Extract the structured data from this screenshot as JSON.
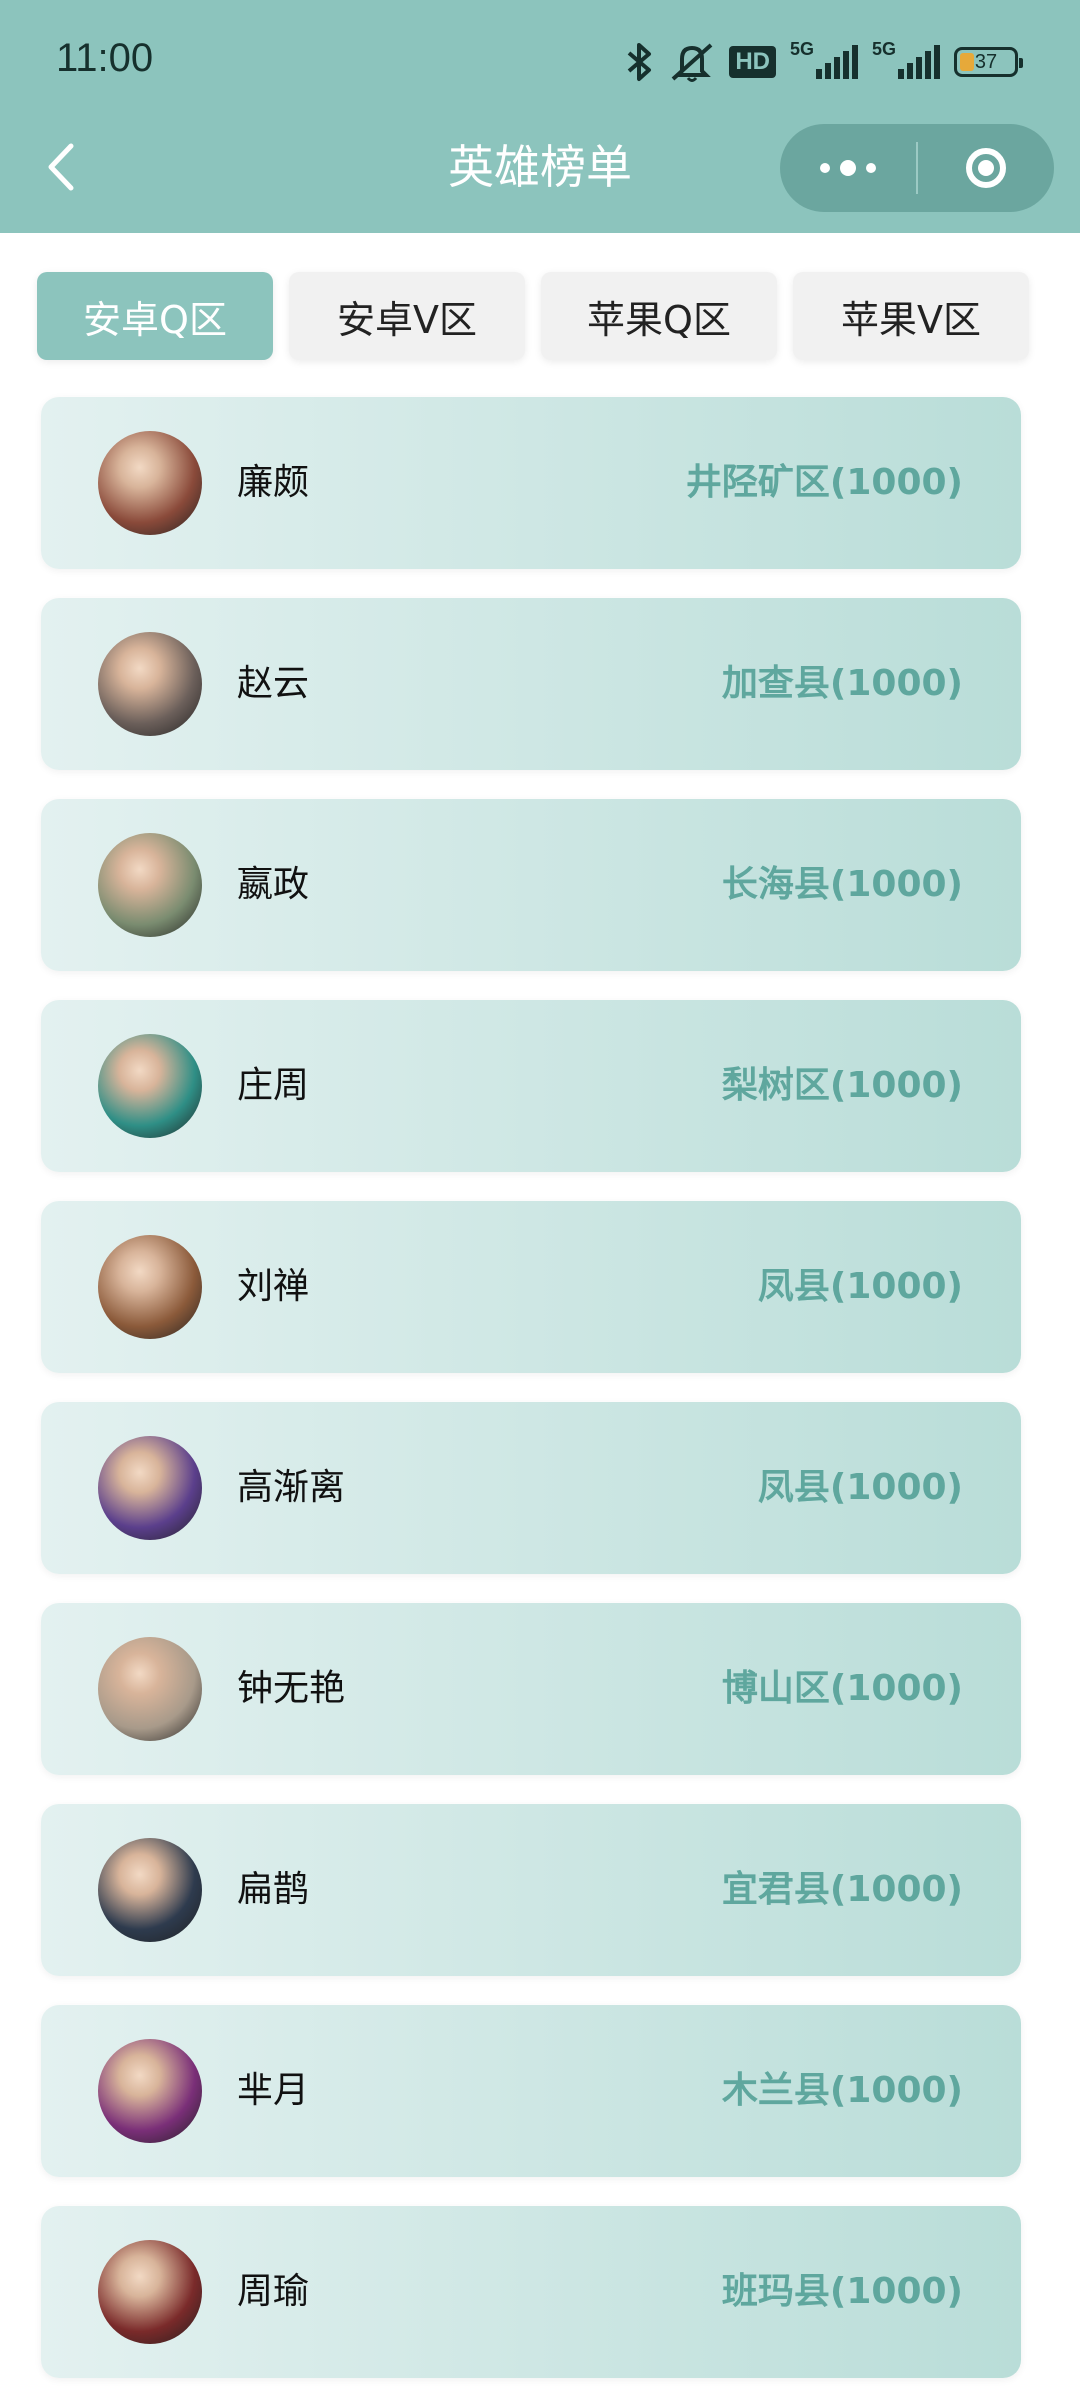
{
  "status_bar": {
    "time": "11:00",
    "icons": [
      "bluetooth-icon",
      "bell-muted-icon",
      "hd-voice-icon",
      "signal-5g-icon",
      "signal-5g-icon",
      "battery-icon"
    ],
    "hd_label": "HD",
    "net1": "5G",
    "net2": "5G",
    "battery": "37"
  },
  "nav": {
    "title": "英雄榜单",
    "back_icon": "chevron-left-icon",
    "more_icon": "more-dots-icon",
    "close_icon": "target-circle-icon"
  },
  "tabs": [
    {
      "label": "安卓Q区",
      "active": true
    },
    {
      "label": "安卓V区",
      "active": false
    },
    {
      "label": "苹果Q区",
      "active": false
    },
    {
      "label": "苹果V区",
      "active": false
    }
  ],
  "heroes": [
    {
      "name": "廉颇",
      "region": "井陉矿区(1000)",
      "avatar_color": "#8a4a3a"
    },
    {
      "name": "赵云",
      "region": "加查县(1000)",
      "avatar_color": "#6b5f5a"
    },
    {
      "name": "嬴政",
      "region": "长海县(1000)",
      "avatar_color": "#7a8c70"
    },
    {
      "name": "庄周",
      "region": "梨树区(1000)",
      "avatar_color": "#2f8f86"
    },
    {
      "name": "刘禅",
      "region": "凤县(1000)",
      "avatar_color": "#8b5a3a"
    },
    {
      "name": "高渐离",
      "region": "凤县(1000)",
      "avatar_color": "#5b3f8c"
    },
    {
      "name": "钟无艳",
      "region": "博山区(1000)",
      "avatar_color": "#a89a8a"
    },
    {
      "name": "扁鹊",
      "region": "宜君县(1000)",
      "avatar_color": "#2e3b4e"
    },
    {
      "name": "芈月",
      "region": "木兰县(1000)",
      "avatar_color": "#7a2f78"
    },
    {
      "name": "周瑜",
      "region": "班玛县(1000)",
      "avatar_color": "#7a2a2a"
    }
  ],
  "colors": {
    "header": "#8cc4bd",
    "accent": "#5fa79e",
    "tab_active": "#8cc4bd"
  }
}
